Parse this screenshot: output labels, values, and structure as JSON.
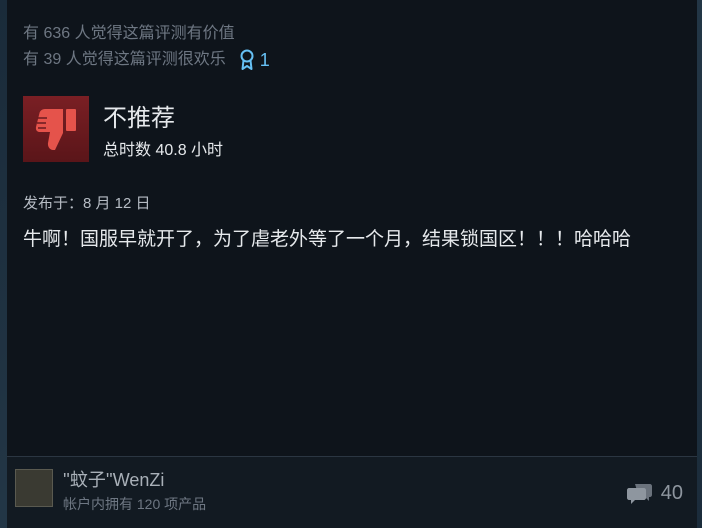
{
  "review": {
    "helpful_text": "有 636 人觉得这篇评测有价值",
    "funny_text": "有 39 人觉得这篇评测很欢乐",
    "award_count": "1",
    "verdict": "不推荐",
    "hours": "总时数 40.8 小时",
    "posted": "发布于：8 月 12 日",
    "body": "牛啊！国服早就开了，为了虐老外等了一个月，结果锁国区！！！哈哈哈"
  },
  "author": {
    "name": "''蚊子''WenZi",
    "products": "帐户内拥有 120 项产品"
  },
  "comments": {
    "count": "40"
  },
  "icons": {
    "verdict_icon": "thumbs-down-icon",
    "award_icon": "award-ribbon-icon",
    "comment_icon": "comment-bubbles-icon"
  },
  "colors": {
    "thumb_bg": "#7a1f24",
    "thumb_fg": "#e5534b",
    "award": "#66c0f4"
  }
}
